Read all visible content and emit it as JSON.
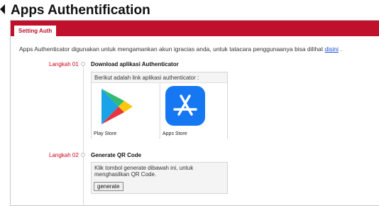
{
  "page": {
    "title": "Apps Authentification"
  },
  "tabs": [
    {
      "label": "Setting Auth",
      "active": true
    }
  ],
  "intro": {
    "text": "Apps Authenticator digunakan untuk mengamankan akun igracias anda, untuk tatacara penggunaanya bisa dilihat ",
    "link_label": "disini",
    "suffix": " ."
  },
  "steps": [
    {
      "label": "Langkah 01",
      "title": "Download aplikasi Authenticator",
      "box_text": "Berikut adalah link aplikasi authenticator :",
      "stores": [
        {
          "label": "Play Store",
          "icon": "play-store-icon"
        },
        {
          "label": "Apps Store",
          "icon": "app-store-icon"
        }
      ]
    },
    {
      "label": "Langkah 02",
      "title": "Generate QR Code",
      "box_text": "Klik tombol generate dibawah ini, untuk menghasilkan QR Code.",
      "button_label": "generate"
    }
  ],
  "colors": {
    "accent": "#c0102b",
    "step_label": "#d0021b",
    "link": "#1a4fd6",
    "app_store_blue": "#1677f2"
  }
}
